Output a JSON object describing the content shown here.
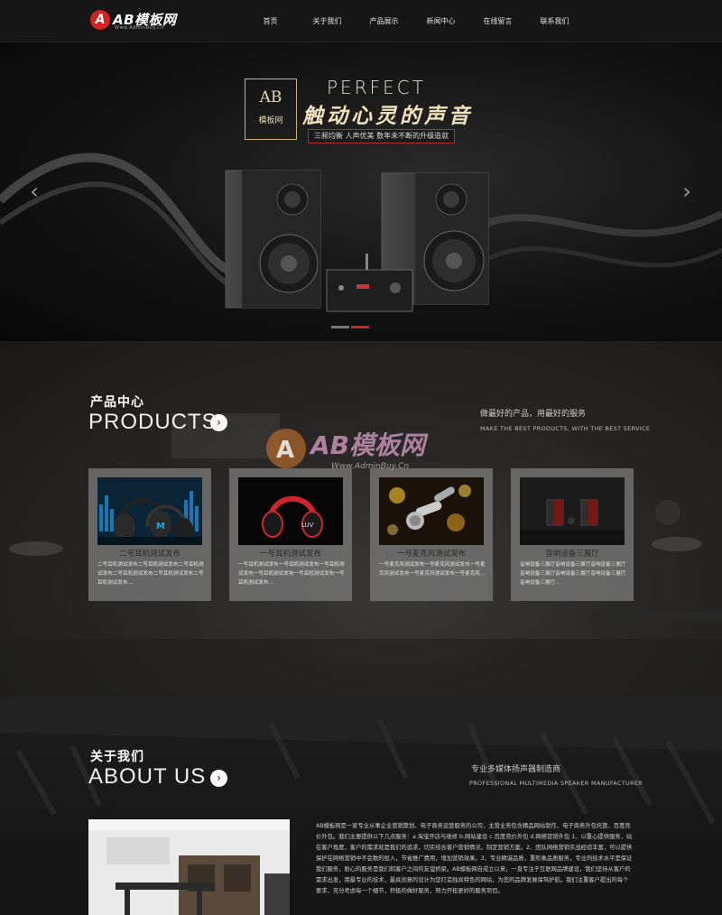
{
  "header": {
    "logo_mark": "A",
    "logo_text": "AB模板网",
    "logo_sub": "Www.AdminBuy.Cn",
    "nav": [
      "首页",
      "关于我们",
      "产品展示",
      "新闻中心",
      "在线留言",
      "联系我们"
    ]
  },
  "banner": {
    "brand_ab": "AB",
    "brand_cn": "模板网",
    "perfect": "PERFECT",
    "slogan": "触动心灵的声音",
    "tagline": "三频均衡 人声优美 数年未不断的升级造就",
    "prev_icon": "chevron-left-icon",
    "next_icon": "chevron-right-icon",
    "slides_total": 2,
    "active_slide": 2
  },
  "products": {
    "cn": "产品中心",
    "en": "PRODUCTS",
    "sub_cn": "做最好的产品，用最好的服务",
    "sub_en": "MAKE THE BEST PRODUCTS, WITH THE BEST SERVICE",
    "items": [
      {
        "title": "二号耳机测试发布",
        "desc": "二号耳机测试发布二号耳机测试发布二号耳机测试发布二号耳机测试发布二号耳机测试发布二号耳机测试发布..."
      },
      {
        "title": "一号耳机测试发布",
        "desc": "一号耳机测试发布一号耳机测试发布一号耳机测试发布一号耳机测试发布一号耳机测试发布一号耳机测试发布..."
      },
      {
        "title": "一号麦克风测试发布",
        "desc": "一号麦克风测试发布一号麦克风测试发布一号麦克风测试发布一号麦克风测试发布一号麦克风..."
      },
      {
        "title": "音响设备三展厅",
        "desc": "音响设备三展厅音响设备三展厅音响设备三展厅音响设备三展厅音响设备三展厅音响设备三展厅音响设备三展厅..."
      }
    ]
  },
  "watermark": {
    "text": "AB模板网",
    "sub": "Www.AdminBuy.Cn"
  },
  "about": {
    "cn": "关于我们",
    "en": "ABOUT US",
    "sub_cn": "专业多媒体扬声器制造商",
    "sub_en": "PROFESSIONAL MULTIMEDIA SPEAKER MANUFACTURER",
    "text": "AB模板网是一家专业从事企业营销策划、电子商务运营服务的公司，主营业务包含精品网站制作、电子商务外包托管、百度竞价外包。我们主要提供以下几点服务：a.淘宝开店与维修 b.网站建设 c.百度竞价外包 d.网络营销外包 1、以重心提供服务，站在客户角度，客户的需求就是我们的追求，切实结合客户营销情况，制定营销方案。2、团队网络营销实战经验丰富，可以提供保护在网络营销中不会数的投入，节省推广费用，增加营销效果。3、专业精诚品质，重形象品质服务，专业的技术水平是保证我们服务，耐心的服务是我们和客户之间的友谊桥梁。AB模板网自成立以来，一直专注于互联网品牌建设，我们坚持从客户的需求出发，用最专业的技术，最具创意的设计为您打造独具特色的网站，为您的品牌发展保驾护航。我们注重客户提出的每个要求，充分考虑每一个细节，积极的做好服务，努力开拓更好的服务项目。"
  }
}
